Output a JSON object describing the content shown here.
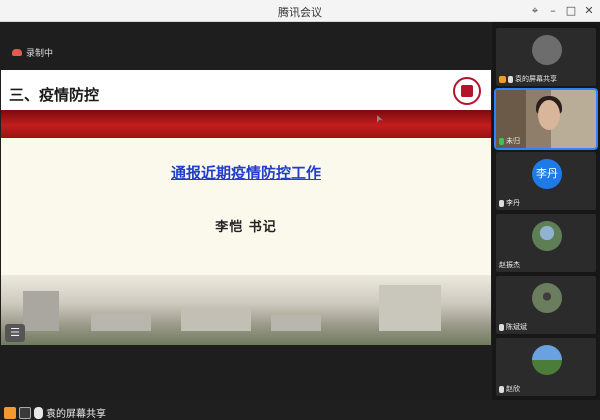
{
  "window": {
    "title": "腾讯会议"
  },
  "recording": {
    "label": "录制中"
  },
  "slide": {
    "section_title": "三、疫情防控",
    "main_title": "通报近期疫情防控工作",
    "speaker": "李恺  书记"
  },
  "bottom_bar": {
    "sharer_label": "袁的屏幕共享"
  },
  "participants": [
    {
      "name": "袁的屏幕共享",
      "type": "image",
      "avatar_color": "#6d6d6d"
    },
    {
      "name": "未归",
      "type": "video"
    },
    {
      "name": "李丹",
      "type": "text",
      "initials": "李丹"
    },
    {
      "name": "赵振杰",
      "type": "image",
      "avatar_color": "#5e7f55"
    },
    {
      "name": "陈斌斌",
      "type": "image",
      "avatar_color": "#6a7d5c"
    },
    {
      "name": "赵欣",
      "type": "image",
      "avatar_color": "#4c7c39"
    }
  ],
  "colors": {
    "accent": "#2a85ff",
    "recording": "#e35a4f",
    "slide_title": "#1f3ec9",
    "banner_red": "#c21d1e"
  }
}
